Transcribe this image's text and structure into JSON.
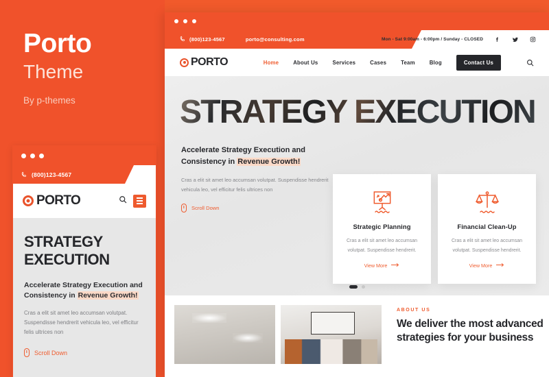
{
  "left_panel": {
    "brand_title": "Porto",
    "brand_subtitle": "Theme",
    "brand_byline": "By p-themes",
    "accent_color": "#f0522b"
  },
  "mobile_mockup": {
    "phone": "(800)123-4567",
    "logo_text": "PORTO",
    "search_icon": "search-icon",
    "menu_icon": "hamburger-icon",
    "hero_title_line1": "STRATEGY",
    "hero_title_line2": "EXECUTION",
    "hero_sub_a": "Accelerate Strategy Execution and",
    "hero_sub_b": "Consistency in ",
    "hero_sub_highlight": "Revenue Growth!",
    "hero_desc": "Cras a elit sit amet leo accumsan volutpat. Suspendisse hendrerit vehicula leo, vel efficitur felis ultrices non",
    "scroll_label": "Scroll Down"
  },
  "desktop_mockup": {
    "topbar": {
      "phone": "(800)123-4567",
      "email": "porto@consulting.com",
      "hours": "Mon - Sat 9:00am - 6:00pm / Sunday - CLOSED",
      "social": [
        "facebook-icon",
        "twitter-icon",
        "instagram-icon"
      ]
    },
    "nav": {
      "logo_text": "PORTO",
      "items": [
        {
          "label": "Home",
          "active": true
        },
        {
          "label": "About Us",
          "active": false
        },
        {
          "label": "Services",
          "active": false
        },
        {
          "label": "Cases",
          "active": false
        },
        {
          "label": "Team",
          "active": false
        },
        {
          "label": "Blog",
          "active": false
        }
      ],
      "contact_button": "Contact Us",
      "search_icon": "search-icon"
    },
    "hero": {
      "title": "STRATEGY EXECUTION",
      "subheading_a": "Accelerate Strategy Execution and",
      "subheading_b": "Consistency in ",
      "subheading_highlight": "Revenue Growth!",
      "description": "Cras a elit sit amet leo accumsan volutpat. Suspendisse hendrerit vehicula leo, vel efficitur felis ultrices non",
      "scroll_label": "Scroll Down"
    },
    "cards": [
      {
        "icon": "presentation-chart-icon",
        "title": "Strategic Planning",
        "description": "Cras a elit sit amet leo accumsan volutpat. Suspendisse hendrerit.",
        "link": "View More"
      },
      {
        "icon": "balance-scales-icon",
        "title": "Financial Clean-Up",
        "description": "Cras a elit sit amet leo accumsan volutpat. Suspendisse hendrerit.",
        "link": "View More"
      }
    ],
    "slider_pages": 2,
    "slider_active": 1,
    "about": {
      "label": "ABOUT US",
      "heading_line1": "We deliver the most advanced",
      "heading_line2": "strategies for your business",
      "photo_1": "office-ceiling-photo",
      "photo_2": "team-meeting-photo"
    }
  }
}
